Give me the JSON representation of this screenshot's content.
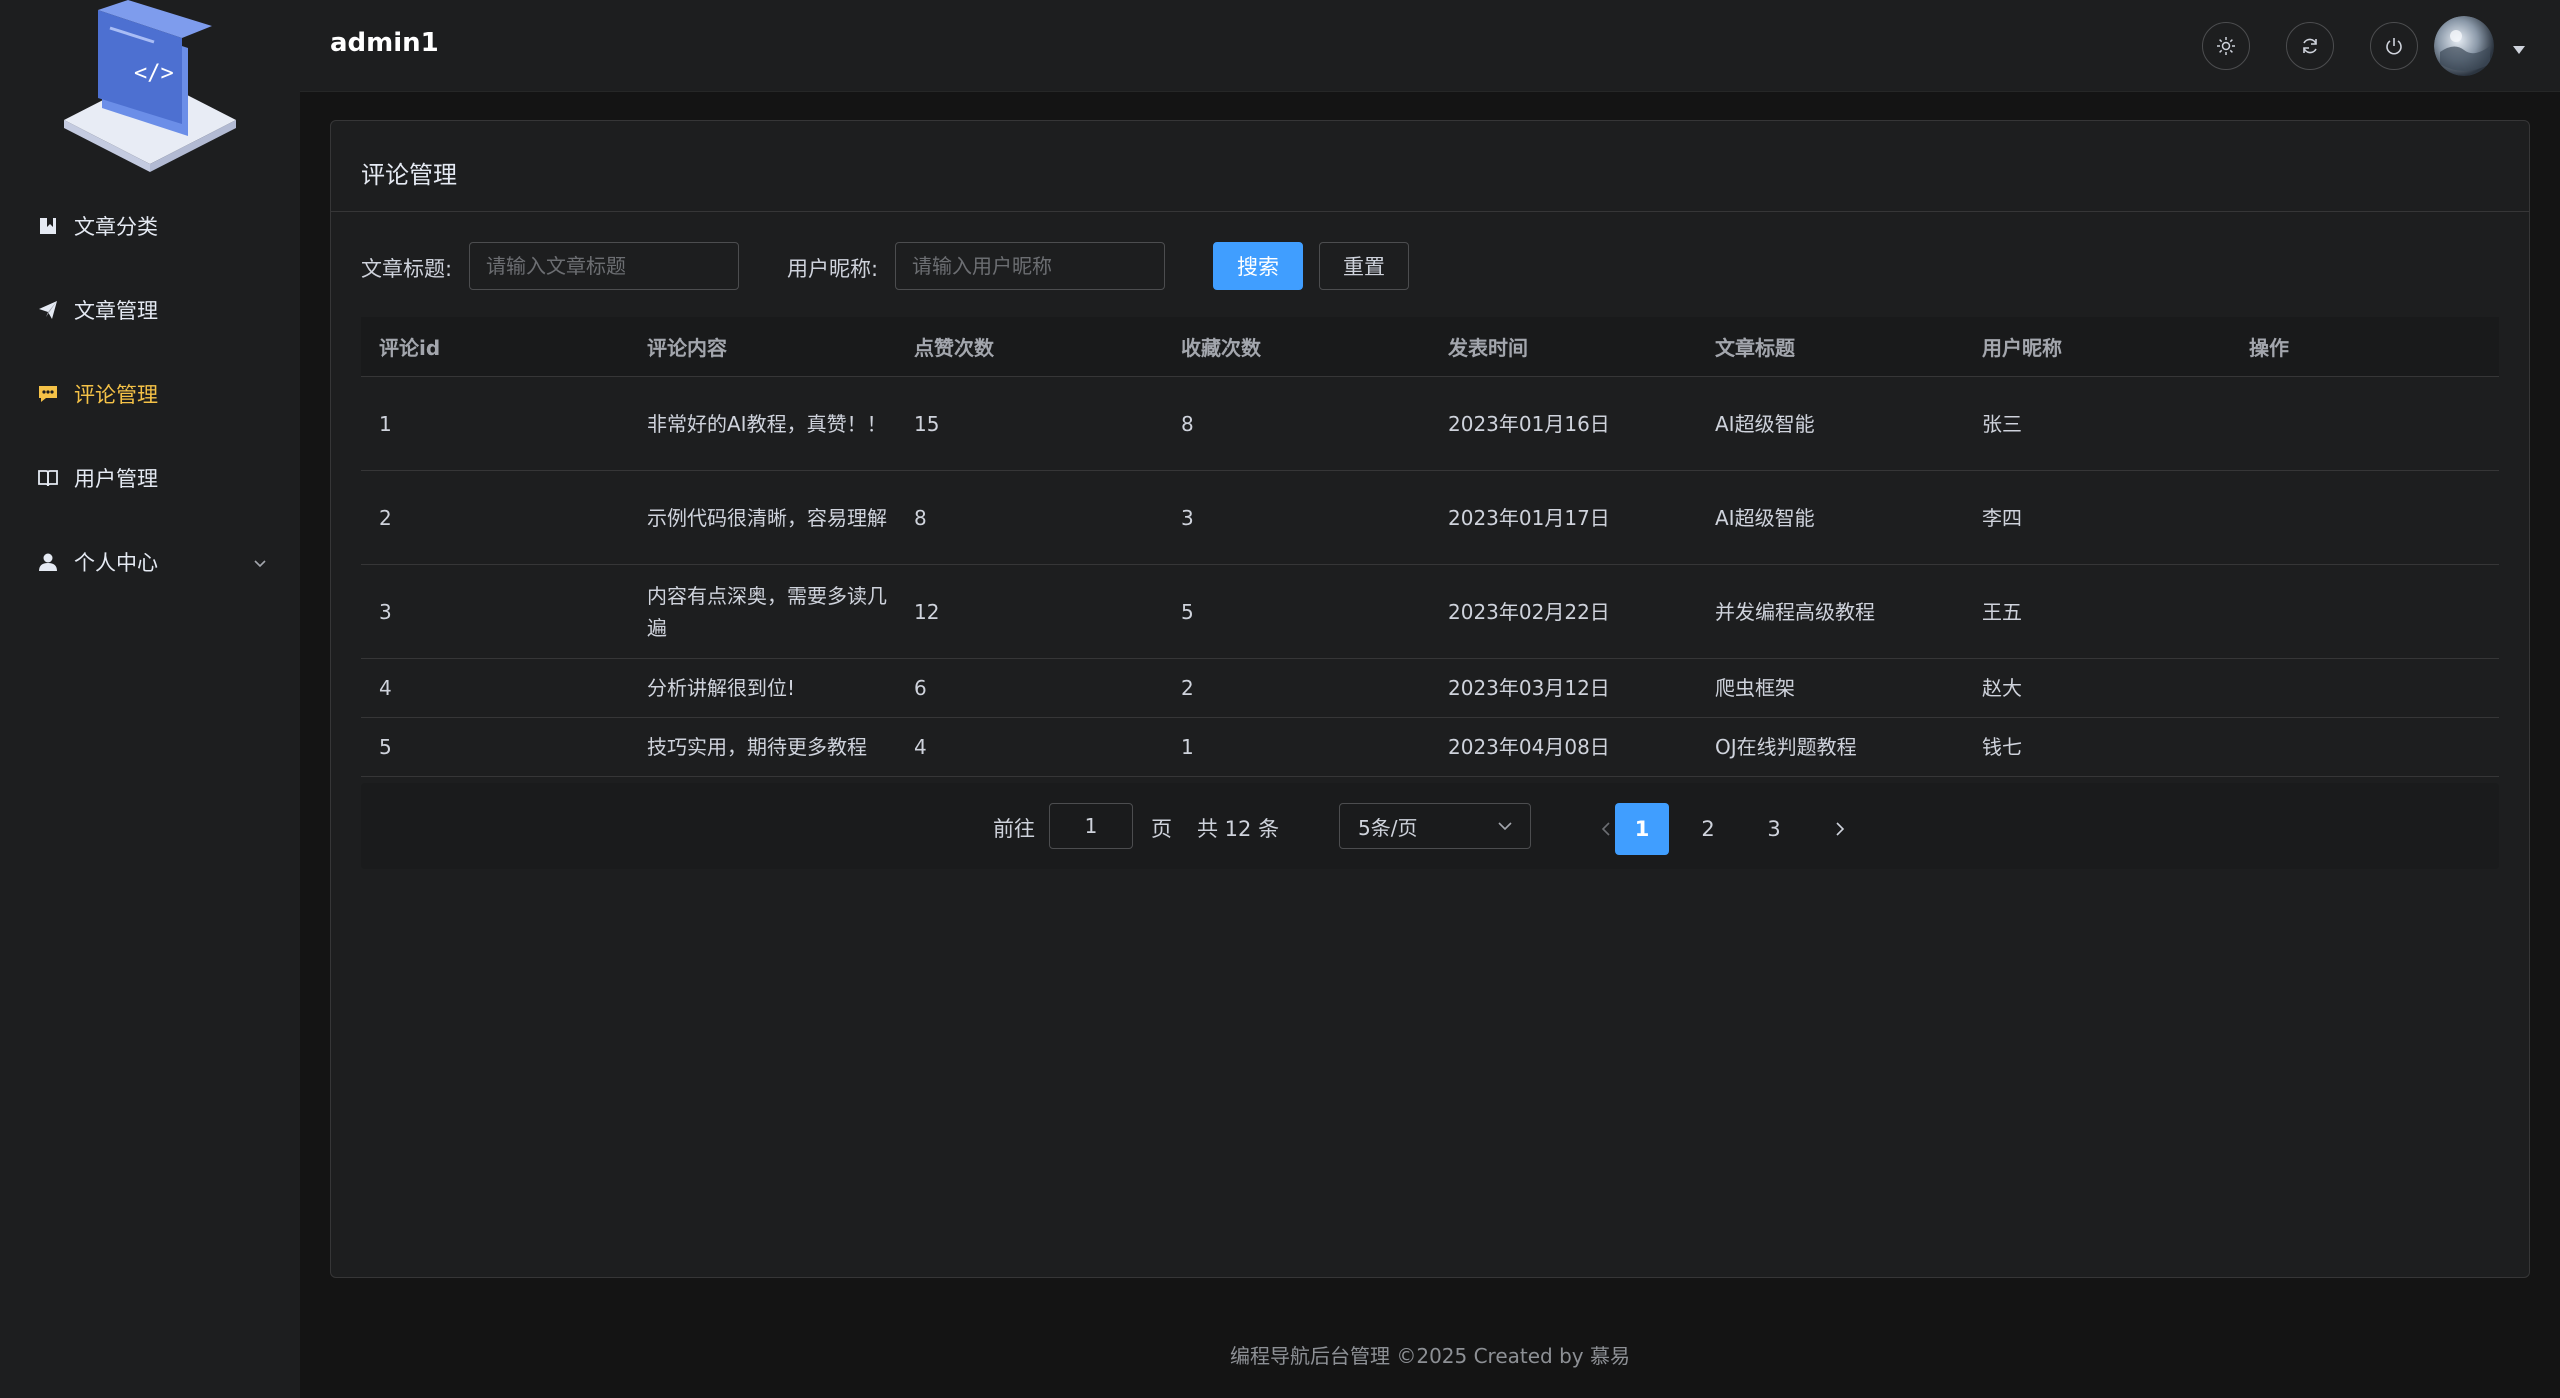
{
  "sidebar": {
    "items": [
      {
        "label": "文章分类",
        "icon": "bookmark-icon"
      },
      {
        "label": "文章管理",
        "icon": "paper-plane-icon"
      },
      {
        "label": "评论管理",
        "icon": "comment-icon",
        "active": true
      },
      {
        "label": "用户管理",
        "icon": "book-open-icon"
      },
      {
        "label": "个人中心",
        "icon": "user-icon"
      }
    ]
  },
  "header": {
    "username": "admin1"
  },
  "page": {
    "title": "评论管理"
  },
  "filters": {
    "title_label": "文章标题:",
    "title_placeholder": "请输入文章标题",
    "nickname_label": "用户昵称:",
    "nickname_placeholder": "请输入用户昵称",
    "search_label": "搜索",
    "reset_label": "重置"
  },
  "table": {
    "columns": [
      "评论id",
      "评论内容",
      "点赞次数",
      "收藏次数",
      "发表时间",
      "文章标题",
      "用户昵称",
      "操作"
    ],
    "rows": [
      [
        "1",
        "非常好的AI教程，真赞！！",
        "15",
        "8",
        "2023年01月16日",
        "AI超级智能",
        "张三",
        ""
      ],
      [
        "2",
        "示例代码很清晰，容易理解",
        "8",
        "3",
        "2023年01月17日",
        "AI超级智能",
        "李四",
        ""
      ],
      [
        "3",
        "内容有点深奥，需要多读几遍",
        "12",
        "5",
        "2023年02月22日",
        "并发编程高级教程",
        "王五",
        ""
      ],
      [
        "4",
        "分析讲解很到位!",
        "6",
        "2",
        "2023年03月12日",
        "爬虫框架",
        "赵大",
        ""
      ],
      [
        "5",
        "技巧实用，期待更多教程",
        "4",
        "1",
        "2023年04月08日",
        "OJ在线判题教程",
        "钱七",
        ""
      ]
    ]
  },
  "pagination": {
    "goto_prefix": "前往",
    "goto_value": "1",
    "goto_suffix": "页",
    "total": "共 12 条",
    "page_size": "5条/页",
    "pages": [
      "1",
      "2",
      "3"
    ],
    "current": "1"
  },
  "footer": {
    "text": "编程导航后台管理 ©2025 Created by 慕易"
  },
  "colors": {
    "accent": "#409eff",
    "active_nav": "#f5c247"
  }
}
